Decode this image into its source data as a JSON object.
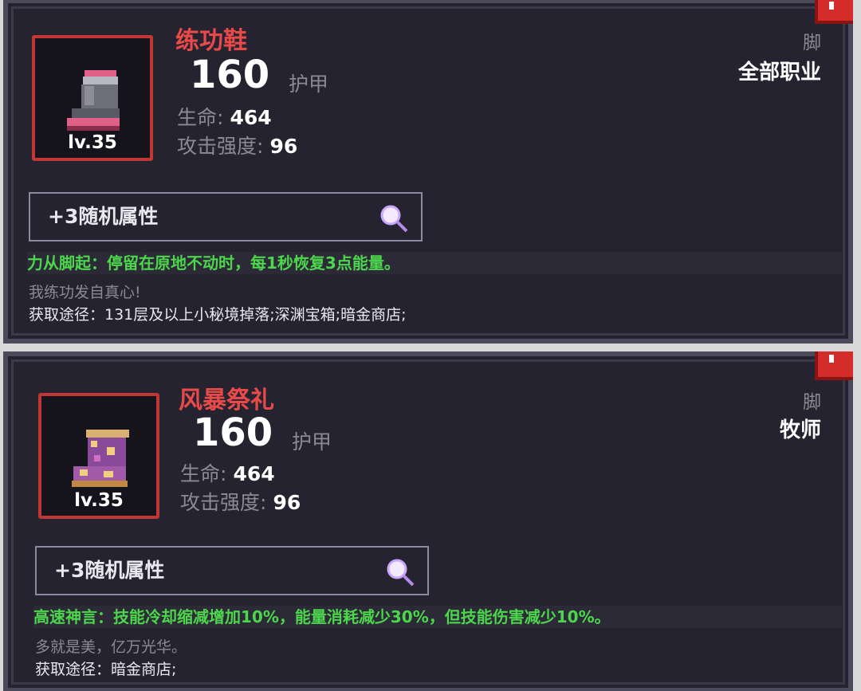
{
  "items": [
    {
      "name": "练功鞋",
      "level": "lv.35",
      "armor_value": "160",
      "armor_label": "护甲",
      "stats": [
        {
          "label": "生命:",
          "value": "464"
        },
        {
          "label": "攻击强度:",
          "value": "96"
        }
      ],
      "slot": "脚",
      "class": "全部职业",
      "random_attr": "+3随机属性",
      "effect": "力从脚起：停留在原地不动时，每1秒恢复3点能量。",
      "flavor": "我练功发自真心!",
      "source": "获取途径：131层及以上小秘境掉落;深渊宝箱;暗金商店;",
      "icon": "pink-gray-boot-icon"
    },
    {
      "name": "风暴祭礼",
      "level": "lv.35",
      "armor_value": "160",
      "armor_label": "护甲",
      "stats": [
        {
          "label": "生命:",
          "value": "464"
        },
        {
          "label": "攻击强度:",
          "value": "96"
        }
      ],
      "slot": "脚",
      "class": "牧师",
      "random_attr": "+3随机属性",
      "effect": "高速神言：技能冷却缩减增加10%，能量消耗减少30%，但技能伤害减少10%。",
      "flavor": "多就是美，亿万光华。",
      "source": "获取途径：暗金商店;",
      "icon": "golden-purple-boot-icon"
    }
  ],
  "colors": {
    "name": "#e84a4a",
    "effect": "#4cd64c",
    "panel": "#25232f",
    "frame": "#c23636"
  }
}
